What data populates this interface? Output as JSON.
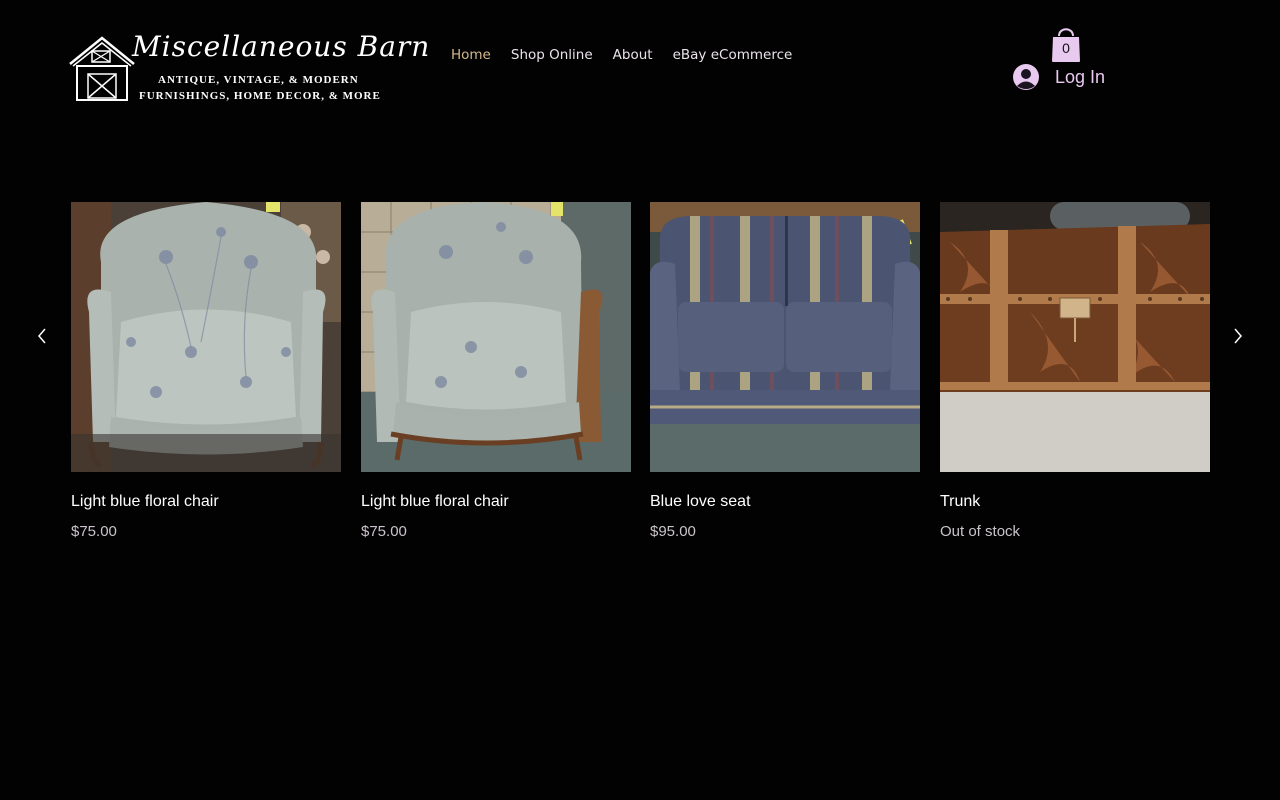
{
  "logo": {
    "brand": "Miscellaneous Barn",
    "tagline_line1": "ANTIQUE, VINTAGE, & MODERN",
    "tagline_line2": "FURNISHINGS, HOME DECOR, & MORE"
  },
  "nav": {
    "items": [
      {
        "label": "Home",
        "active": true
      },
      {
        "label": "Shop Online",
        "active": false
      },
      {
        "label": "About",
        "active": false
      },
      {
        "label": "eBay eCommerce",
        "active": false
      }
    ]
  },
  "cart": {
    "count": "0",
    "color": "#e8c9ef"
  },
  "login": {
    "label": "Log In"
  },
  "products": [
    {
      "name": "Light blue floral chair",
      "price": "$75.00",
      "image_icon": "floral-armchair-photo"
    },
    {
      "name": "Light blue floral chair",
      "price": "$75.00",
      "image_icon": "floral-armchair-photo"
    },
    {
      "name": "Blue love seat",
      "price": "$95.00",
      "image_icon": "striped-loveseat-photo"
    },
    {
      "name": "Trunk",
      "price": "Out of stock",
      "image_icon": "wooden-trunk-photo"
    }
  ],
  "colors": {
    "background": "#030203",
    "nav_active": "#d3b98a",
    "nav_text": "#e9e4ea",
    "accent": "#e8c9ef"
  }
}
